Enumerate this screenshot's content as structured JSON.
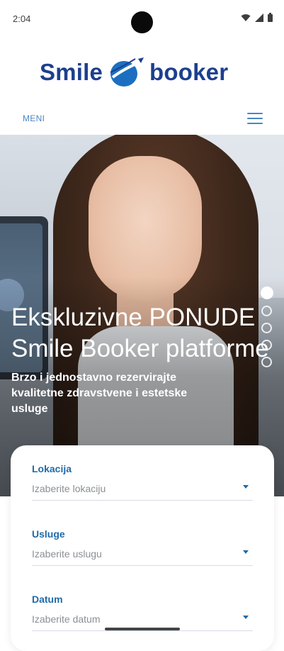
{
  "status": {
    "time": "2:04"
  },
  "header": {
    "logo_left": "Smile",
    "logo_right": "booker",
    "menu_label": "MENI"
  },
  "hero": {
    "title_line1": "Ekskluzivne PONUDE",
    "title_line2": "Smile Booker platforme",
    "subtitle": "Brzo i jednostavno rezervirajte kvalitetne zdravstvene i estetske usluge",
    "slides": 5,
    "active_slide": 1
  },
  "booking": {
    "fields": [
      {
        "label": "Lokacija",
        "placeholder": "Izaberite lokaciju"
      },
      {
        "label": "Usluge",
        "placeholder": "Izaberite uslugu"
      },
      {
        "label": "Datum",
        "placeholder": "Izaberite datum"
      }
    ]
  },
  "colors": {
    "brand_blue": "#1c3f8f",
    "accent_blue": "#4b86c4",
    "label_blue": "#1f6aa8"
  },
  "icons": [
    "wifi-icon",
    "signal-icon",
    "battery-icon",
    "globe-logo-icon",
    "hamburger-menu-icon",
    "caret-down-icon"
  ]
}
